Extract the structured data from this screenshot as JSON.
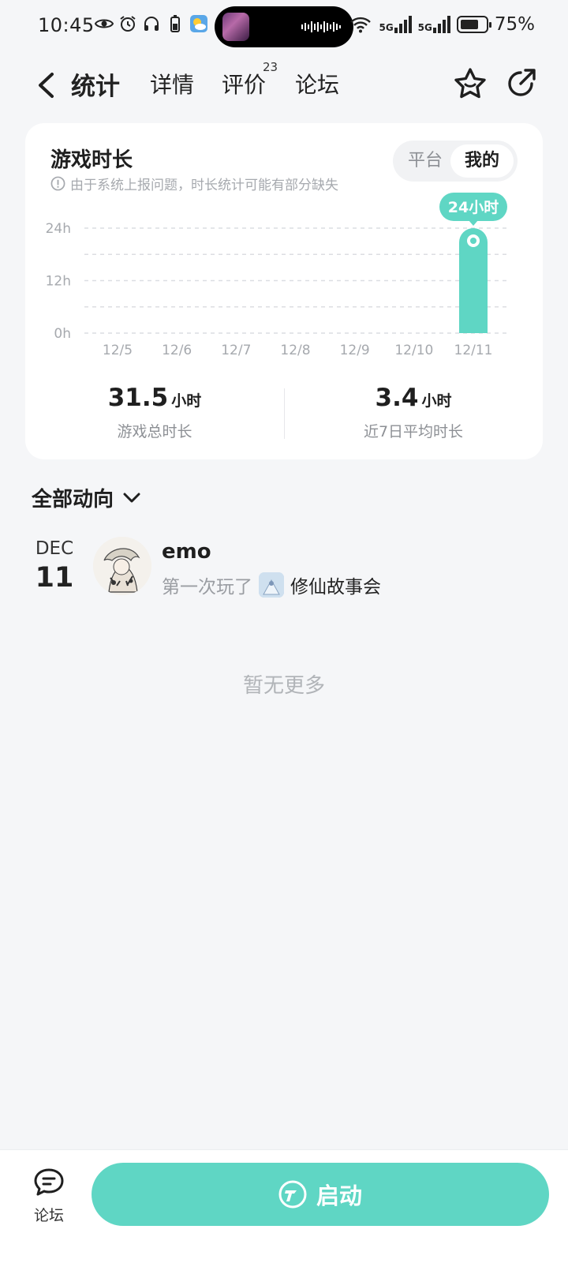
{
  "status_bar": {
    "time": "10:45",
    "battery_percent": "75%",
    "battery_level": 0.75,
    "network_1": "5G",
    "network_2": "5G"
  },
  "nav": {
    "tabs": [
      {
        "label": "统计",
        "active": true
      },
      {
        "label": "详情"
      },
      {
        "label": "评价",
        "badge": "23"
      },
      {
        "label": "论坛"
      }
    ]
  },
  "stats_card": {
    "title": "游戏时长",
    "note": "由于系统上报问题，时长统计可能有部分缺失",
    "toggle": {
      "platform": "平台",
      "mine": "我的"
    },
    "total": {
      "value": "31.5",
      "unit": "小时",
      "label": "游戏总时长"
    },
    "average": {
      "value": "3.4",
      "unit": "小时",
      "label": "近7日平均时长"
    }
  },
  "chart_data": {
    "type": "bar",
    "categories": [
      "12/5",
      "12/6",
      "12/7",
      "12/8",
      "12/9",
      "12/10",
      "12/11"
    ],
    "values": [
      0,
      0,
      0,
      0,
      0,
      0,
      24
    ],
    "y_ticks": [
      "0h",
      "12h",
      "24h"
    ],
    "ylim": [
      0,
      24
    ],
    "highlight_label": "24小时",
    "highlight_index": 6,
    "grid": true,
    "bar_color": "#5fd6c4"
  },
  "activity": {
    "section_title": "全部动向",
    "items": [
      {
        "month": "DEC",
        "day": "11",
        "user": "emo",
        "action": "第一次玩了",
        "game": "修仙故事会"
      }
    ],
    "no_more": "暂无更多"
  },
  "bottom_bar": {
    "forum_label": "论坛",
    "launch_label": "启动"
  },
  "colors": {
    "accent": "#5fd6c4",
    "background": "#f5f6f8"
  }
}
